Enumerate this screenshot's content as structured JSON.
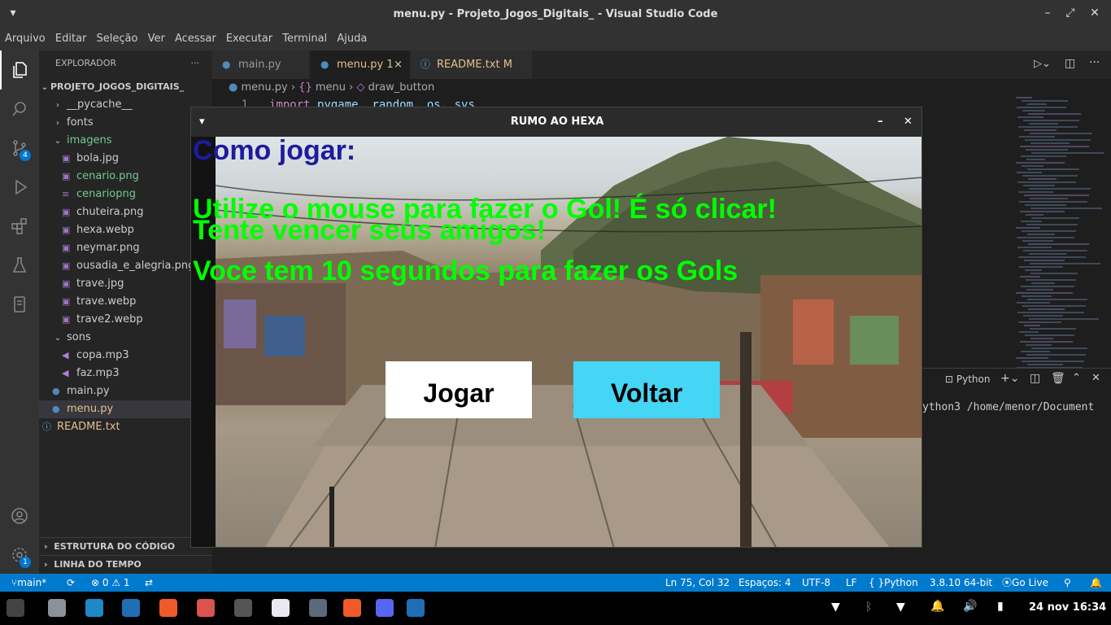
{
  "window": {
    "title": "menu.py - Projeto_Jogos_Digitais_ - Visual Studio Code"
  },
  "menubar": [
    "Arquivo",
    "Editar",
    "Seleção",
    "Ver",
    "Acessar",
    "Executar",
    "Terminal",
    "Ajuda"
  ],
  "activity": {
    "scm_badge": "4",
    "settings_badge": "1"
  },
  "explorer": {
    "header": "EXPLORADOR",
    "project": "PROJETO_JOGOS_DIGITAIS_",
    "items": [
      {
        "label": "__pycache__",
        "kind": "folder",
        "depth": 1,
        "open": false
      },
      {
        "label": "fonts",
        "kind": "folder",
        "depth": 1,
        "open": false
      },
      {
        "label": "imagens",
        "kind": "folder",
        "depth": 1,
        "open": true,
        "color": "#73c991"
      },
      {
        "label": "bola.jpg",
        "kind": "image",
        "depth": 2
      },
      {
        "label": "cenario.png",
        "kind": "image",
        "depth": 2,
        "color": "#73c991"
      },
      {
        "label": "cenariopng",
        "kind": "text",
        "depth": 2,
        "color": "#73c991"
      },
      {
        "label": "chuteira.png",
        "kind": "image",
        "depth": 2
      },
      {
        "label": "hexa.webp",
        "kind": "image",
        "depth": 2
      },
      {
        "label": "neymar.png",
        "kind": "image",
        "depth": 2
      },
      {
        "label": "ousadia_e_alegria.png",
        "kind": "image",
        "depth": 2
      },
      {
        "label": "trave.jpg",
        "kind": "image",
        "depth": 2
      },
      {
        "label": "trave.webp",
        "kind": "image",
        "depth": 2
      },
      {
        "label": "trave2.webp",
        "kind": "image",
        "depth": 2
      },
      {
        "label": "sons",
        "kind": "folder",
        "depth": 1,
        "open": true
      },
      {
        "label": "copa.mp3",
        "kind": "audio",
        "depth": 2
      },
      {
        "label": "faz.mp3",
        "kind": "audio",
        "depth": 2
      },
      {
        "label": "main.py",
        "kind": "python",
        "depth": 1
      },
      {
        "label": "menu.py",
        "kind": "python",
        "depth": 1,
        "color": "#e2c08d",
        "selected": true
      },
      {
        "label": "README.txt",
        "kind": "info",
        "depth": 0,
        "color": "#e2c08d"
      }
    ],
    "sections": [
      "ESTRUTURA DO CÓDIGO",
      "LINHA DO TEMPO"
    ]
  },
  "tabs": [
    {
      "label": "main.py",
      "extra": "",
      "active": false
    },
    {
      "label": "menu.py",
      "extra": "1",
      "active": true
    },
    {
      "label": "README.txt",
      "extra": "M",
      "active": false
    }
  ],
  "breadcrumb": {
    "file": "menu.py",
    "symbol1": "menu",
    "symbol2": "draw_button"
  },
  "code": {
    "line_number": "1",
    "keyword": "import",
    "rest": " pygame, random, os, sys"
  },
  "panel": {
    "label": "Python",
    "terminal_text": "ython3 /home/menor/Document"
  },
  "statusbar": {
    "branch": "main*",
    "problems": "⊗ 0 ⚠ 1",
    "position": "Ln 75, Col 32",
    "spaces": "Espaços: 4",
    "encoding": "UTF-8",
    "eol": "LF",
    "language": "Python",
    "interpreter": "3.8.10 64-bit",
    "golive": "Go Live"
  },
  "taskbar": {
    "clock": "24 nov 16:34"
  },
  "game": {
    "title": "RUMO AO HEXA",
    "heading": "Como jogar:",
    "line1": "Utilize o mouse para fazer o Gol! É só clicar!",
    "line2": "Tente vencer seus amigos!",
    "line3": "Voce tem 10 segundos para fazer os Gols",
    "btn_play": "Jogar",
    "btn_back": "Voltar",
    "heading_color": "#1c1c9e",
    "text_color": "#00ff00",
    "back_color": "#45d5f5"
  }
}
